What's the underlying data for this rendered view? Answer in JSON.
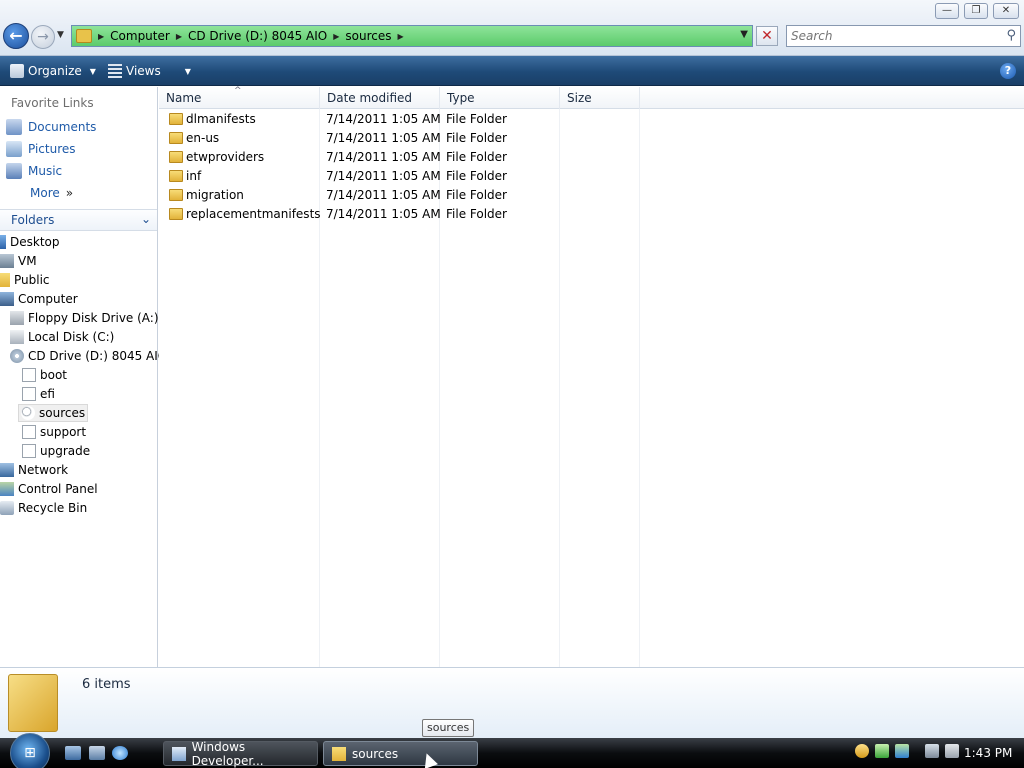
{
  "window": {
    "minimize_glyph": "—",
    "maximize_glyph": "❐",
    "close_glyph": "✕"
  },
  "address": {
    "crumbs": [
      "Computer",
      "CD Drive (D:) 8045 AIO",
      "sources"
    ],
    "separator": "▶",
    "accent": "#6fd680"
  },
  "search": {
    "placeholder": "Search"
  },
  "toolbar": {
    "organize_label": "Organize",
    "views_label": "Views",
    "help_label": "?"
  },
  "sidebar": {
    "favorites_title": "Favorite Links",
    "favorites": [
      {
        "label": "Documents",
        "icon": "documents-icon"
      },
      {
        "label": "Pictures",
        "icon": "pictures-icon"
      },
      {
        "label": "Music",
        "icon": "music-icon"
      },
      {
        "label": "More",
        "icon": "chevron-double-right-icon"
      }
    ],
    "more_chevron": "»",
    "folders_title": "Folders",
    "folders_toggle": "⌄",
    "tree": [
      {
        "label": "Desktop",
        "icon": "desktop-icon"
      },
      {
        "label": "VM",
        "icon": "user-folder-icon"
      },
      {
        "label": "Public",
        "icon": "folder-icon"
      },
      {
        "label": "Computer",
        "icon": "computer-icon"
      },
      {
        "label": "Floppy Disk Drive (A:)",
        "icon": "floppy-icon"
      },
      {
        "label": "Local Disk (C:)",
        "icon": "disk-icon"
      },
      {
        "label": "CD Drive (D:) 8045 AIO",
        "icon": "cd-icon"
      },
      {
        "label": "boot",
        "icon": "blank-folder-icon"
      },
      {
        "label": "efi",
        "icon": "blank-folder-icon"
      },
      {
        "label": "sources",
        "icon": "search-folder-icon",
        "selected": true
      },
      {
        "label": "support",
        "icon": "blank-folder-icon"
      },
      {
        "label": "upgrade",
        "icon": "blank-folder-icon"
      },
      {
        "label": "Network",
        "icon": "network-icon"
      },
      {
        "label": "Control Panel",
        "icon": "control-panel-icon"
      },
      {
        "label": "Recycle Bin",
        "icon": "recycle-bin-icon"
      }
    ]
  },
  "filelist": {
    "columns": [
      "Name",
      "Date modified",
      "Type",
      "Size"
    ],
    "sort_indicator": "^",
    "rows": [
      {
        "name": "dlmanifests",
        "date": "7/14/2011 1:05 AM",
        "type": "File Folder",
        "size": ""
      },
      {
        "name": "en-us",
        "date": "7/14/2011 1:05 AM",
        "type": "File Folder",
        "size": ""
      },
      {
        "name": "etwproviders",
        "date": "7/14/2011 1:05 AM",
        "type": "File Folder",
        "size": ""
      },
      {
        "name": "inf",
        "date": "7/14/2011 1:05 AM",
        "type": "File Folder",
        "size": ""
      },
      {
        "name": "migration",
        "date": "7/14/2011 1:05 AM",
        "type": "File Folder",
        "size": ""
      },
      {
        "name": "replacementmanifests",
        "date": "7/14/2011 1:05 AM",
        "type": "File Folder",
        "size": ""
      }
    ]
  },
  "details": {
    "item_count": "6 items"
  },
  "taskbar": {
    "buttons": [
      {
        "label": "Windows Developer...",
        "icon": "ie-page-icon"
      },
      {
        "label": "sources",
        "icon": "folder-icon"
      }
    ],
    "clock": "1:43 PM",
    "tooltip": "sources"
  }
}
